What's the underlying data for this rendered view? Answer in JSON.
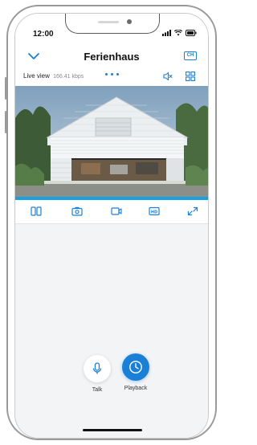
{
  "status_bar": {
    "time": "12:00",
    "icons": [
      "signal-icon",
      "wifi-icon",
      "battery-icon"
    ]
  },
  "header": {
    "title": "Ferienhaus",
    "back_icon": "chevron-down-icon",
    "quality_label": "CH"
  },
  "live": {
    "label": "Live view",
    "bitrate": "166.41 kbps",
    "icons": [
      "speaker-muted-icon",
      "grid-icon"
    ]
  },
  "video": {
    "scene": "camera-feed-house"
  },
  "toolbar": {
    "items": [
      "split-view-icon",
      "snapshot-icon",
      "record-icon",
      "hd-icon",
      "fullscreen-icon"
    ]
  },
  "actions": {
    "talk_label": "Talk",
    "playback_label": "Playback"
  },
  "colors": {
    "accent": "#1a7fd6",
    "progress": "#1a9fe0",
    "background": "#f3f4f6"
  }
}
